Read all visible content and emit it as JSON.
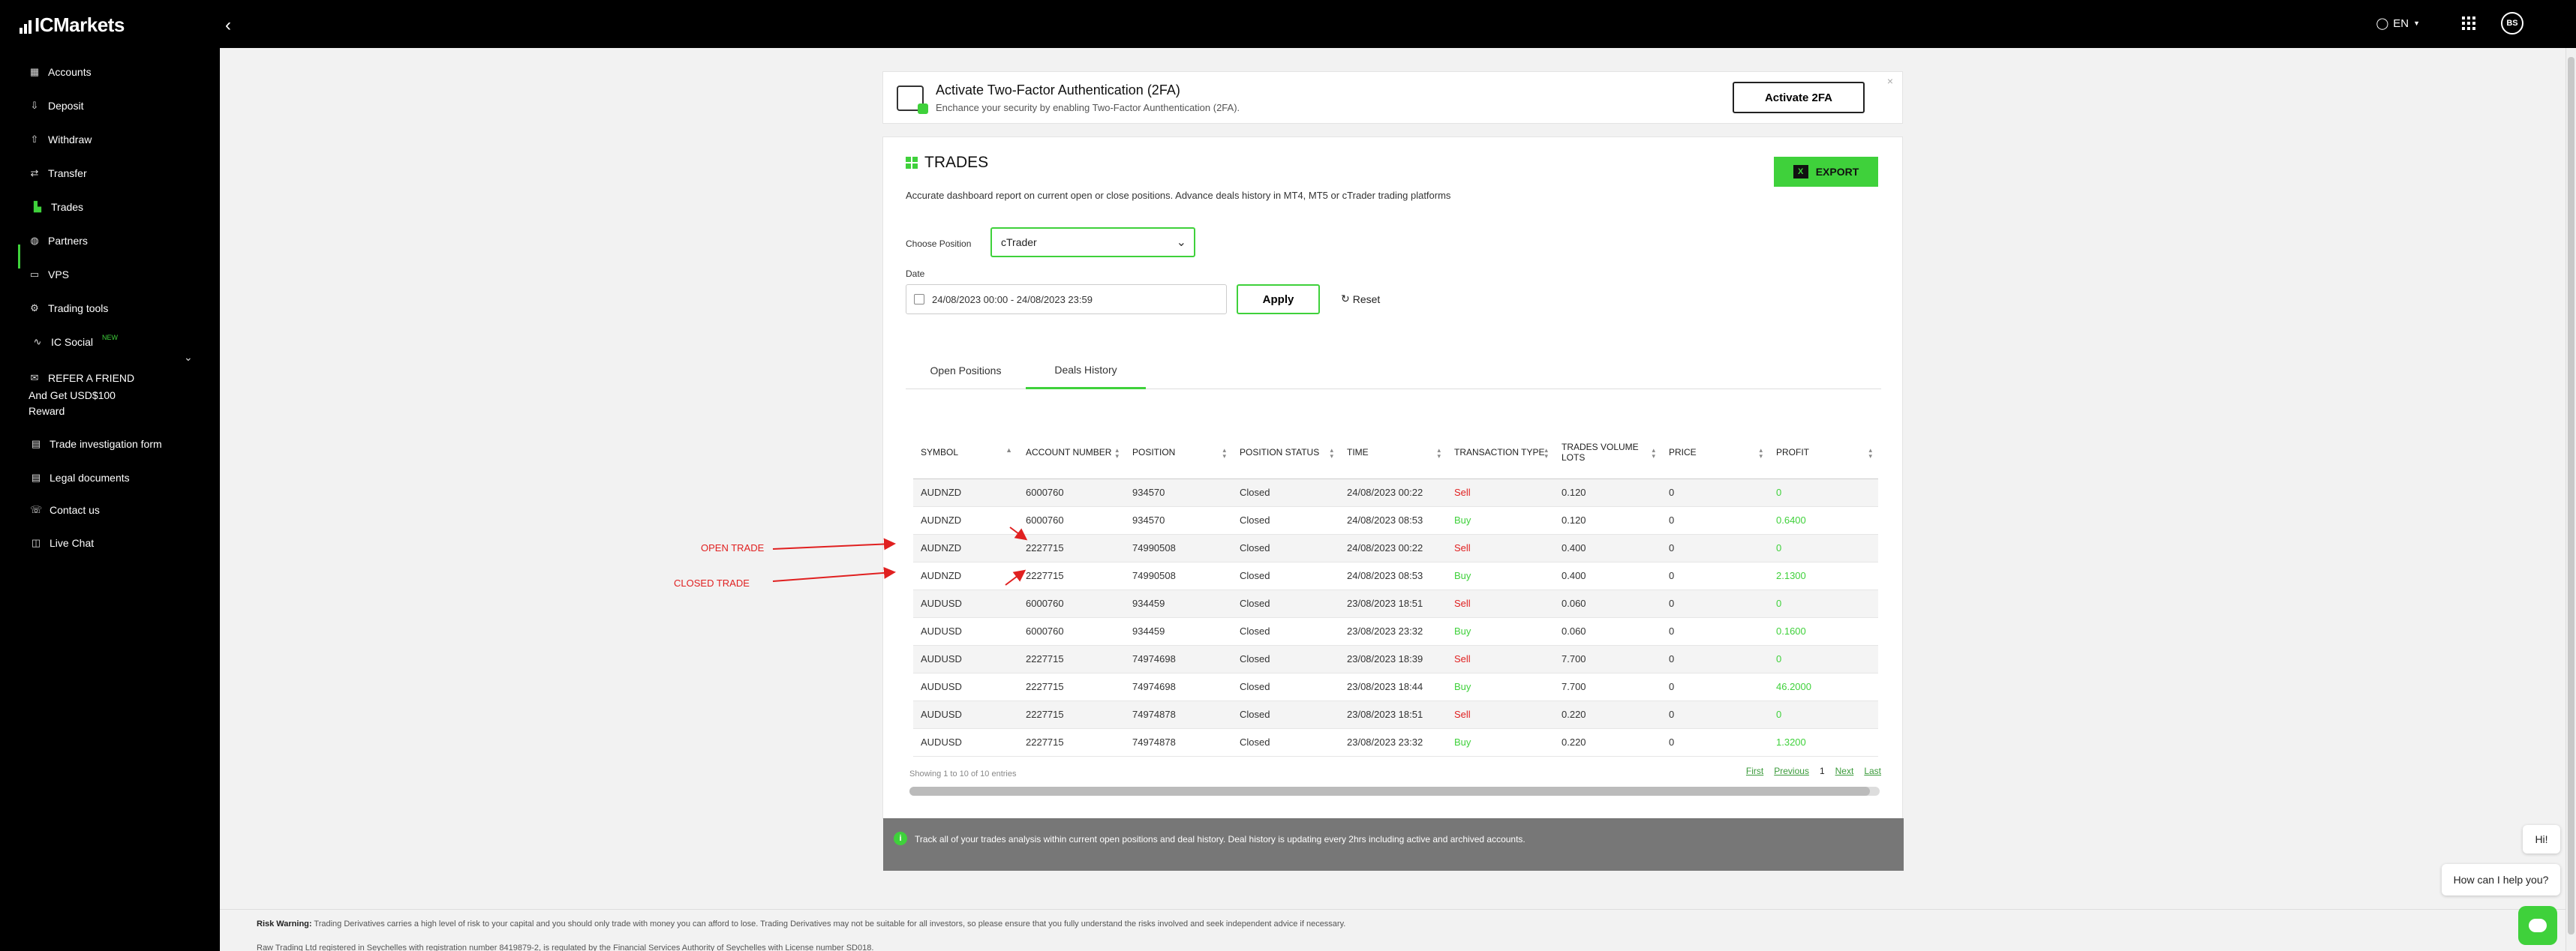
{
  "brand": {
    "logo": "ICMarkets",
    "accent": "#3fd13b"
  },
  "topbar": {
    "lang": "EN",
    "avatar": "BS"
  },
  "sidebar": {
    "items": [
      {
        "label": "Accounts",
        "icon": "accounts-icon"
      },
      {
        "label": "Deposit",
        "icon": "deposit-icon"
      },
      {
        "label": "Withdraw",
        "icon": "withdraw-icon"
      },
      {
        "label": "Transfer",
        "icon": "transfer-icon"
      },
      {
        "label": "Trades",
        "icon": "trades-icon"
      },
      {
        "label": "Partners",
        "icon": "partners-icon"
      },
      {
        "label": "VPS",
        "icon": "vps-icon"
      },
      {
        "label": "Trading tools",
        "icon": "trading-tools-icon"
      },
      {
        "label": "IC Social",
        "icon": "ic-social-icon",
        "badge": "NEW"
      },
      {
        "label": "REFER A FRIEND",
        "icon": "gift-icon"
      },
      {
        "label": "Trade investigation form",
        "icon": "form-icon"
      },
      {
        "label": "Legal documents",
        "icon": "document-icon"
      },
      {
        "label": "Contact us",
        "icon": "contact-icon"
      },
      {
        "label": "Live Chat",
        "icon": "chat-icon"
      }
    ],
    "refer_line2": "And Get USD$100",
    "refer_line3": "Reward"
  },
  "twofa": {
    "title": "Activate Two-Factor Authentication (2FA)",
    "subtitle": "Enchance your security by enabling Two-Factor Aunthentication (2FA).",
    "button": "Activate 2FA",
    "close": "×"
  },
  "trades": {
    "title": "TRADES",
    "export": "EXPORT",
    "description": "Accurate dashboard report on current open or close positions. Advance deals history in MT4, MT5 or cTrader trading platforms",
    "choose_position_label": "Choose Position",
    "choose_position_value": "cTrader",
    "date_label": "Date",
    "date_value": "24/08/2023 00:00 - 24/08/2023 23:59",
    "apply": "Apply",
    "reset": "Reset",
    "tabs": [
      "Open Positions",
      "Deals History"
    ],
    "active_tab": "Deals History"
  },
  "table": {
    "headers": [
      "SYMBOL",
      "ACCOUNT NUMBER",
      "POSITION",
      "POSITION STATUS",
      "TIME",
      "TRANSACTION TYPE",
      "TRADES VOLUME LOTS",
      "PRICE",
      "PROFIT"
    ],
    "rows": [
      [
        "AUDNZD",
        "6000760",
        "934570",
        "Closed",
        "24/08/2023 00:22",
        "Sell",
        "0.120",
        "0",
        "0"
      ],
      [
        "AUDNZD",
        "6000760",
        "934570",
        "Closed",
        "24/08/2023 08:53",
        "Buy",
        "0.120",
        "0",
        "0.6400"
      ],
      [
        "AUDNZD",
        "2227715",
        "74990508",
        "Closed",
        "24/08/2023 00:22",
        "Sell",
        "0.400",
        "0",
        "0"
      ],
      [
        "AUDNZD",
        "2227715",
        "74990508",
        "Closed",
        "24/08/2023 08:53",
        "Buy",
        "0.400",
        "0",
        "2.1300"
      ],
      [
        "AUDUSD",
        "6000760",
        "934459",
        "Closed",
        "23/08/2023 18:51",
        "Sell",
        "0.060",
        "0",
        "0"
      ],
      [
        "AUDUSD",
        "6000760",
        "934459",
        "Closed",
        "23/08/2023 23:32",
        "Buy",
        "0.060",
        "0",
        "0.1600"
      ],
      [
        "AUDUSD",
        "2227715",
        "74974698",
        "Closed",
        "23/08/2023 18:39",
        "Sell",
        "7.700",
        "0",
        "0"
      ],
      [
        "AUDUSD",
        "2227715",
        "74974698",
        "Closed",
        "23/08/2023 18:44",
        "Buy",
        "7.700",
        "0",
        "46.2000"
      ],
      [
        "AUDUSD",
        "2227715",
        "74974878",
        "Closed",
        "23/08/2023 18:51",
        "Sell",
        "0.220",
        "0",
        "0"
      ],
      [
        "AUDUSD",
        "2227715",
        "74974878",
        "Closed",
        "23/08/2023 23:32",
        "Buy",
        "0.220",
        "0",
        "1.3200"
      ]
    ],
    "showing": "Showing 1 to 10 of 10 entries",
    "pager": {
      "first": "First",
      "previous": "Previous",
      "page": "1",
      "next": "Next",
      "last": "Last"
    }
  },
  "info_bar": "Track all of your trades analysis within current open positions and deal history. Deal history is updating every 2hrs including active and archived accounts.",
  "annotations": {
    "open_trade": "OPEN TRADE",
    "closed_trade": "CLOSED TRADE"
  },
  "risk": {
    "label": "Risk Warning:",
    "text": "Trading Derivatives carries a high level of risk to your capital and you should only trade with money you can afford to lose. Trading Derivatives may not be suitable for all investors, so please ensure that you fully understand the risks involved and seek independent advice if necessary.",
    "text2": "Raw Trading Ltd registered in Seychelles with registration number 8419879-2, is regulated by the Financial Services Authority of Seychelles with License number SD018."
  },
  "chat": {
    "hi": "Hi!",
    "help": "How can I help you?"
  }
}
